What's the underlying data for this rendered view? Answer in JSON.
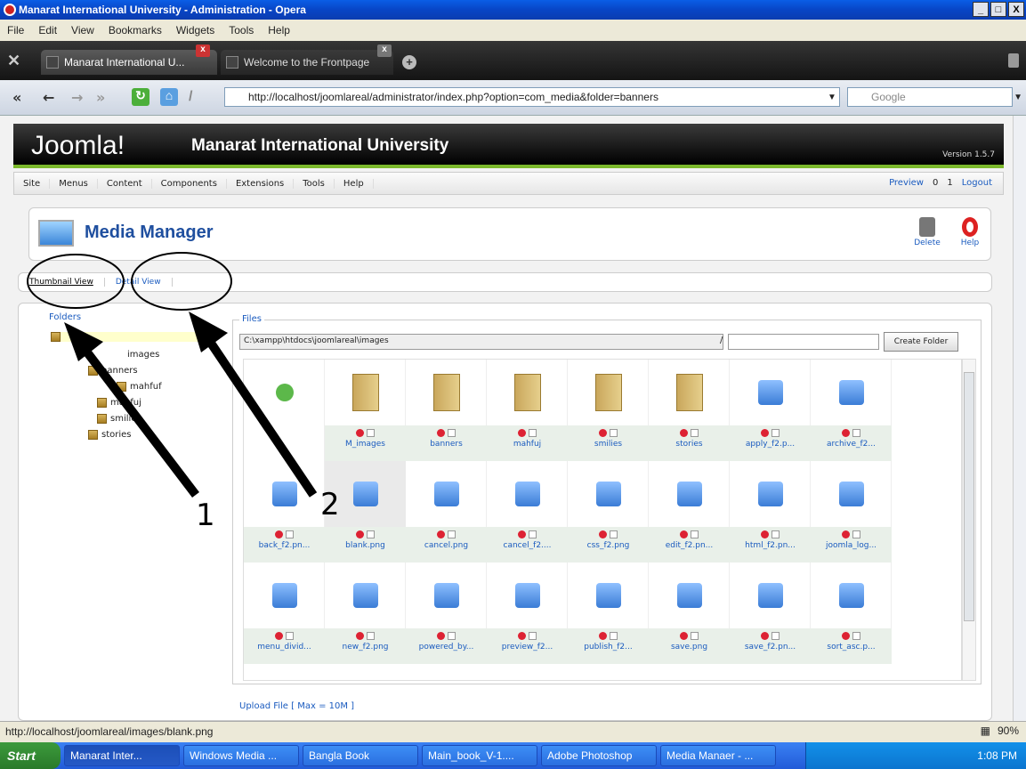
{
  "window": {
    "title": "Manarat International University - Administration - Opera",
    "buttons": [
      "_",
      "□",
      "X"
    ]
  },
  "menu": [
    "File",
    "Edit",
    "View",
    "Bookmarks",
    "Widgets",
    "Tools",
    "Help"
  ],
  "tabs": [
    {
      "label": "Manarat International U..."
    },
    {
      "label": "Welcome to the Frontpage"
    }
  ],
  "address": {
    "url": "http://localhost/joomlareal/administrator/index.php?option=com_media&folder=banners",
    "search_placeholder": "Google"
  },
  "joomla": {
    "logo": "Joomla!",
    "site": "Manarat International University",
    "version": "Version 1.5.7",
    "menu": [
      "Site",
      "Menus",
      "Content",
      "Components",
      "Extensions",
      "Tools",
      "Help"
    ],
    "status": {
      "preview": "Preview",
      "messages": "0",
      "users": "1",
      "logout": "Logout"
    }
  },
  "page": {
    "title": "Media Manager",
    "delete": "Delete",
    "help": "Help",
    "view_thumb": "Thumbnail View",
    "view_detail": "Detail View"
  },
  "folders": {
    "legend": "Folders",
    "items": [
      "",
      "images",
      "banners",
      "mahfuf",
      "mahfuj",
      "smilies",
      "stories"
    ]
  },
  "files": {
    "legend": "Files",
    "path": "C:\\xampp\\htdocs\\joomlareal\\images",
    "slash": "/",
    "create": "Create Folder",
    "items": [
      "",
      "M_images",
      "banners",
      "mahfuj",
      "smilies",
      "stories",
      "apply_f2.p...",
      "archive_f2...",
      "back_f2.pn...",
      "blank.png",
      "cancel.png",
      "cancel_f2....",
      "css_f2.png",
      "edit_f2.pn...",
      "html_f2.pn...",
      "joomla_log...",
      "menu_divid...",
      "new_f2.png",
      "powered_by...",
      "preview_f2...",
      "publish_f2...",
      "save.png",
      "save_f2.pn...",
      "sort_asc.p..."
    ]
  },
  "upload": {
    "legend": "Upload File [ Max = 10M ]"
  },
  "annotations": {
    "one": "1",
    "two": "2"
  },
  "statusbar": {
    "url": "http://localhost/joomlareal/images/blank.png",
    "zoom": "90%"
  },
  "taskbar": {
    "start": "Start",
    "items": [
      "Manarat Inter...",
      "Windows Media ...",
      "Bangla Book",
      "Main_book_V-1....",
      "Adobe Photoshop",
      "Media Manaer - ..."
    ],
    "time": "1:08 PM"
  }
}
